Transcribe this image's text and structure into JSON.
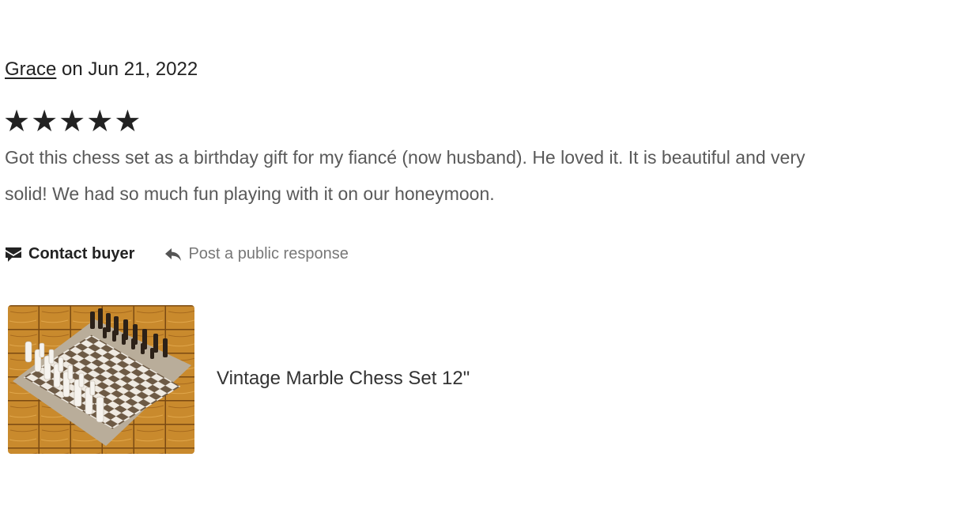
{
  "review": {
    "reviewer_name": "Grace",
    "date_text": " on Jun 21, 2022",
    "rating": 5,
    "stars": [
      "★",
      "★",
      "★",
      "★",
      "★"
    ],
    "text_lines": [
      "Got this chess set as a birthday gift for my fiancé (now husband). He loved it. It is beautiful and very",
      "solid! We had so much fun playing with it on our honeymoon."
    ]
  },
  "actions": {
    "contact_buyer": {
      "label": "Contact buyer",
      "icon": "message-icon"
    },
    "public_response": {
      "label": "Post a public response",
      "icon": "reply-icon"
    }
  },
  "product": {
    "title": "Vintage Marble Chess Set 12\"",
    "image": "chess-set-thumbnail"
  },
  "colors": {
    "text_primary": "#222222",
    "text_secondary": "#595959",
    "text_muted": "#777777"
  }
}
